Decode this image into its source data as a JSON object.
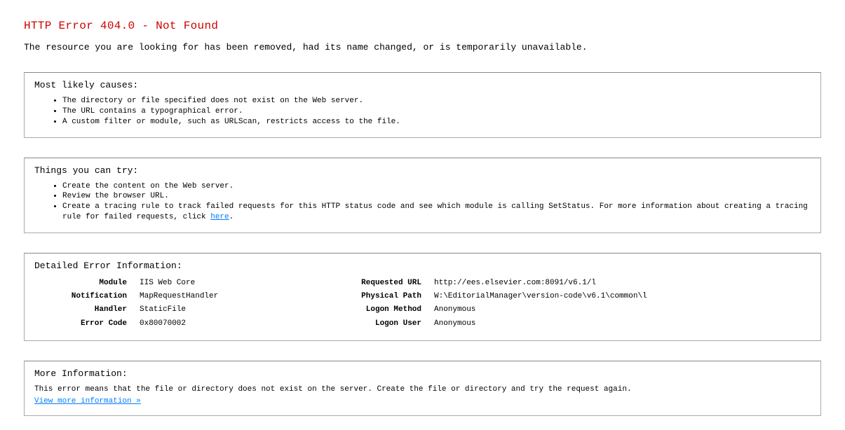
{
  "header": {
    "title": "HTTP Error 404.0 - Not Found",
    "description": "The resource you are looking for has been removed, had its name changed, or is temporarily unavailable."
  },
  "causes": {
    "title": "Most likely causes:",
    "items": [
      "The directory or file specified does not exist on the Web server.",
      "The URL contains a typographical error.",
      "A custom filter or module, such as URLScan, restricts access to the file."
    ]
  },
  "tries": {
    "title": "Things you can try:",
    "items": {
      "0": "Create the content on the Web server.",
      "1": "Review the browser URL.",
      "2_prefix": "Create a tracing rule to track failed requests for this HTTP status code and see which module is calling SetStatus. For more information about creating a tracing rule for failed requests, click ",
      "2_link": "here",
      "2_suffix": "."
    }
  },
  "details": {
    "title": "Detailed Error Information:",
    "left": {
      "module_label": "Module",
      "module_value": "IIS Web Core",
      "notification_label": "Notification",
      "notification_value": "MapRequestHandler",
      "handler_label": "Handler",
      "handler_value": "StaticFile",
      "error_code_label": "Error Code",
      "error_code_value": "0x80070002"
    },
    "right": {
      "requested_url_label": "Requested URL",
      "requested_url_value": "http://ees.elsevier.com:8091/v6.1/l",
      "physical_path_label": "Physical Path",
      "physical_path_value": "W:\\EditorialManager\\version-code\\v6.1\\common\\l",
      "logon_method_label": "Logon Method",
      "logon_method_value": "Anonymous",
      "logon_user_label": "Logon User",
      "logon_user_value": "Anonymous"
    }
  },
  "more": {
    "title": "More Information:",
    "text": "This error means that the file or directory does not exist on the server. Create the file or directory and try the request again.",
    "link": "View more information »"
  }
}
